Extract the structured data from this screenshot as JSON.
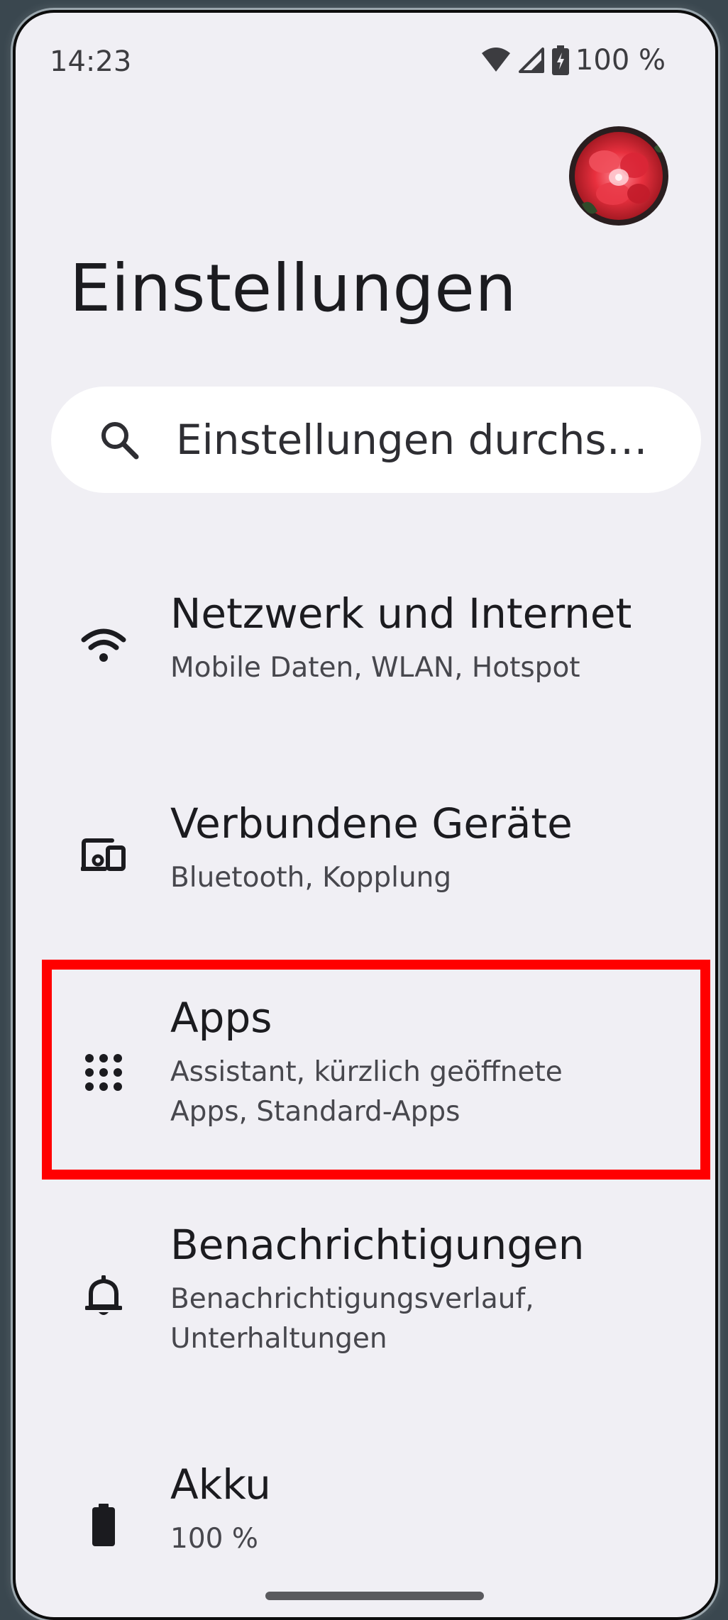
{
  "status_bar": {
    "time": "14:23",
    "battery_text": "100 %",
    "icons": [
      "wifi-icon",
      "cell-signal-icon",
      "battery-charging-icon"
    ]
  },
  "page": {
    "title": "Einstellungen"
  },
  "search": {
    "placeholder": "Einstellungen durchs…",
    "icon": "search-icon"
  },
  "settings_items": [
    {
      "title": "Netzwerk und Internet",
      "subtitle": "Mobile Daten, WLAN, Hotspot",
      "icon": "wifi-icon"
    },
    {
      "title": "Verbundene Geräte",
      "subtitle": "Bluetooth, Kopplung",
      "icon": "connected-devices-icon"
    },
    {
      "title": "Apps",
      "subtitle": "Assistant, kürzlich geöffnete Apps, Standard-Apps",
      "icon": "apps-grid-icon"
    },
    {
      "title": "Benachrichtigungen",
      "subtitle": "Benachrichtigungsverlauf, Unterhaltungen",
      "icon": "bell-icon"
    },
    {
      "title": "Akku",
      "subtitle": "100 %",
      "icon": "battery-icon"
    }
  ],
  "colors": {
    "background": "#f0eff4",
    "highlight": "#ff0000",
    "text_primary": "#1b1b1f",
    "text_secondary": "#47474d"
  }
}
